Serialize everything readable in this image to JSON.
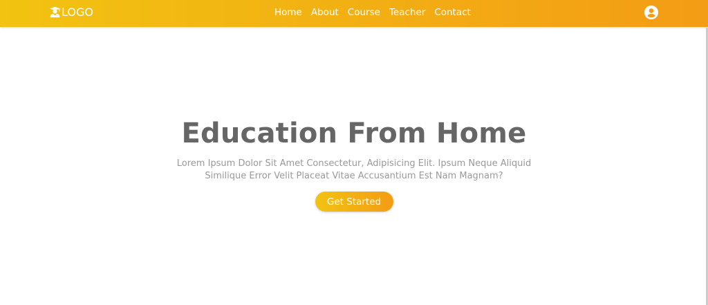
{
  "header": {
    "logo_text": "LOGO",
    "nav": [
      "Home",
      "About",
      "Course",
      "Teacher",
      "Contact"
    ]
  },
  "hero": {
    "title": "Education From Home",
    "description": "Lorem Ipsum Dolor Sit Amet Consectetur, Adipisicing Elit. Ipsum Neque Aliquid Similique Error Velit Placeat Vitae Accusantium Est Nam Magnam?",
    "cta": "Get Started"
  }
}
